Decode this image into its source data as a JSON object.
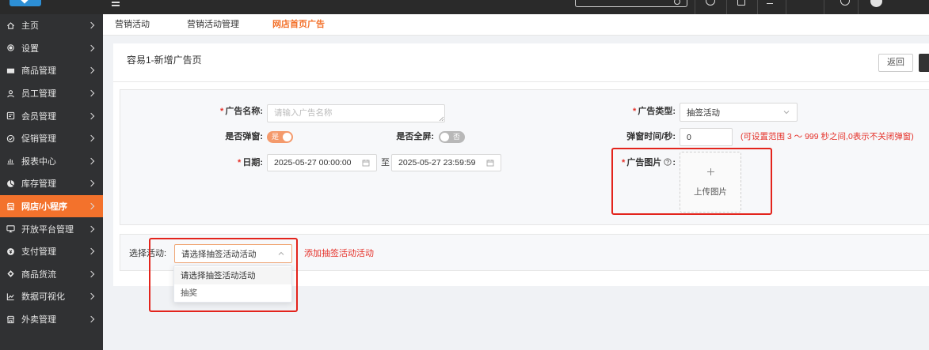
{
  "topbar": {
    "icons": [
      "logo",
      "menu-icon",
      "search-icon",
      "help-icon",
      "document-icon",
      "download-icon",
      "settings-icon",
      "avatar"
    ]
  },
  "sidebar": {
    "items": [
      {
        "label": "主页",
        "icon": "home-icon"
      },
      {
        "label": "设置",
        "icon": "settings-icon"
      },
      {
        "label": "商品管理",
        "icon": "product-icon"
      },
      {
        "label": "员工管理",
        "icon": "staff-icon"
      },
      {
        "label": "会员管理",
        "icon": "member-icon"
      },
      {
        "label": "促销管理",
        "icon": "promotion-icon"
      },
      {
        "label": "报表中心",
        "icon": "report-icon"
      },
      {
        "label": "库存管理",
        "icon": "inventory-icon"
      },
      {
        "label": "网店/小程序",
        "icon": "store-icon",
        "active": true
      },
      {
        "label": "开放平台管理",
        "icon": "platform-icon"
      },
      {
        "label": "支付管理",
        "icon": "payment-icon"
      },
      {
        "label": "商品货流",
        "icon": "logistics-icon"
      },
      {
        "label": "数据可视化",
        "icon": "chart-icon"
      },
      {
        "label": "外卖管理",
        "icon": "delivery-icon"
      }
    ]
  },
  "tabs": [
    {
      "label": "营销活动"
    },
    {
      "label": "营销活动管理"
    },
    {
      "label": "网店首页广告",
      "active": true
    }
  ],
  "page": {
    "title": "容易1-新增广告页",
    "back_button": "返回"
  },
  "required_mark": "*",
  "form": {
    "ad_name": {
      "label": "广告名称:",
      "placeholder": "请输入广告名称"
    },
    "ad_type": {
      "label": "广告类型:",
      "value": "抽签活动"
    },
    "popup": {
      "label": "是否弹窗:",
      "value": true,
      "text": "是"
    },
    "fullscreen": {
      "label": "是否全屏:",
      "value": false,
      "text": "否"
    },
    "popup_seconds": {
      "label": "弹窗时间/秒:",
      "value": "0",
      "hint": "(可设置范围 3 ～ 999 秒之间,0表示不关闭弹窗)"
    },
    "date": {
      "label": "日期:",
      "start": "2025-05-27 00:00:00",
      "separator": "至",
      "end": "2025-05-27 23:59:59"
    },
    "ad_image": {
      "label": "广告图片",
      "colon": ":",
      "upload_text": "上传图片"
    }
  },
  "activity": {
    "label": "选择活动:",
    "selected": "请选择抽签活动活动",
    "add_link": "添加抽签活动活动",
    "open": true,
    "options": [
      "请选择抽签活动活动",
      "抽奖"
    ],
    "highlighted_index": 0
  },
  "colors": {
    "accent": "#f3722c",
    "danger": "#e53028",
    "sidebar_bg": "#303133",
    "topbar_bg": "#2a2a2a",
    "highlight": "#e3241c",
    "toggle_on": "#f49a6c",
    "toggle_off": "#b8b8b8"
  }
}
